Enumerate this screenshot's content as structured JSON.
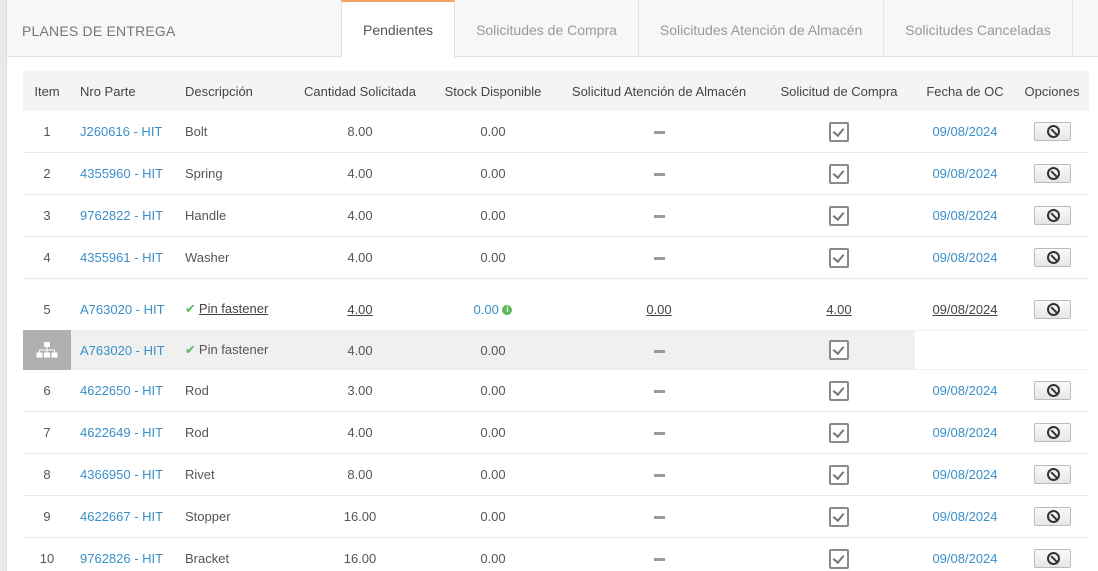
{
  "panel": {
    "title": "PLANES DE ENTREGA",
    "tabs": [
      "Pendientes",
      "Solicitudes de Compra",
      "Solicitudes Atención de Almacén",
      "Solicitudes Canceladas"
    ]
  },
  "table": {
    "headers": [
      "Item",
      "Nro Parte",
      "Descripción",
      "Cantidad Solicitada",
      "Stock Disponible",
      "Solicitud Atención de Almacén",
      "Solicitud de Compra",
      "Fecha de OC",
      "Opciones"
    ],
    "rows": [
      {
        "item": "1",
        "part": "J260616 - HIT",
        "desc": "Bolt",
        "qty": "8.00",
        "stock": "0.00",
        "date": "09/08/2024"
      },
      {
        "item": "2",
        "part": "4355960 - HIT",
        "desc": "Spring",
        "qty": "4.00",
        "stock": "0.00",
        "date": "09/08/2024"
      },
      {
        "item": "3",
        "part": "9762822 - HIT",
        "desc": "Handle",
        "qty": "4.00",
        "stock": "0.00",
        "date": "09/08/2024"
      },
      {
        "item": "4",
        "part": "4355961 - HIT",
        "desc": "Washer",
        "qty": "4.00",
        "stock": "0.00",
        "date": "09/08/2024"
      }
    ],
    "selected": {
      "item": "5",
      "part": "A763020 - HIT",
      "desc": "Pin fastener",
      "qty": "4.00",
      "stock": "0.00",
      "atencion": "0.00",
      "compra": "4.00",
      "date": "09/08/2024"
    },
    "subrow": {
      "part": "A763020 - HIT",
      "desc": "Pin fastener",
      "qty": "4.00",
      "stock": "0.00"
    },
    "rows2": [
      {
        "item": "6",
        "part": "4622650 - HIT",
        "desc": "Rod",
        "qty": "3.00",
        "stock": "0.00",
        "date": "09/08/2024"
      },
      {
        "item": "7",
        "part": "4622649 - HIT",
        "desc": "Rod",
        "qty": "4.00",
        "stock": "0.00",
        "date": "09/08/2024"
      },
      {
        "item": "8",
        "part": "4366950 - HIT",
        "desc": "Rivet",
        "qty": "8.00",
        "stock": "0.00",
        "date": "09/08/2024"
      },
      {
        "item": "9",
        "part": "4622667 - HIT",
        "desc": "Stopper",
        "qty": "16.00",
        "stock": "0.00",
        "date": "09/08/2024"
      },
      {
        "item": "10",
        "part": "9762826 - HIT",
        "desc": "Bracket",
        "qty": "16.00",
        "stock": "0.00",
        "date": "09/08/2024"
      }
    ]
  }
}
